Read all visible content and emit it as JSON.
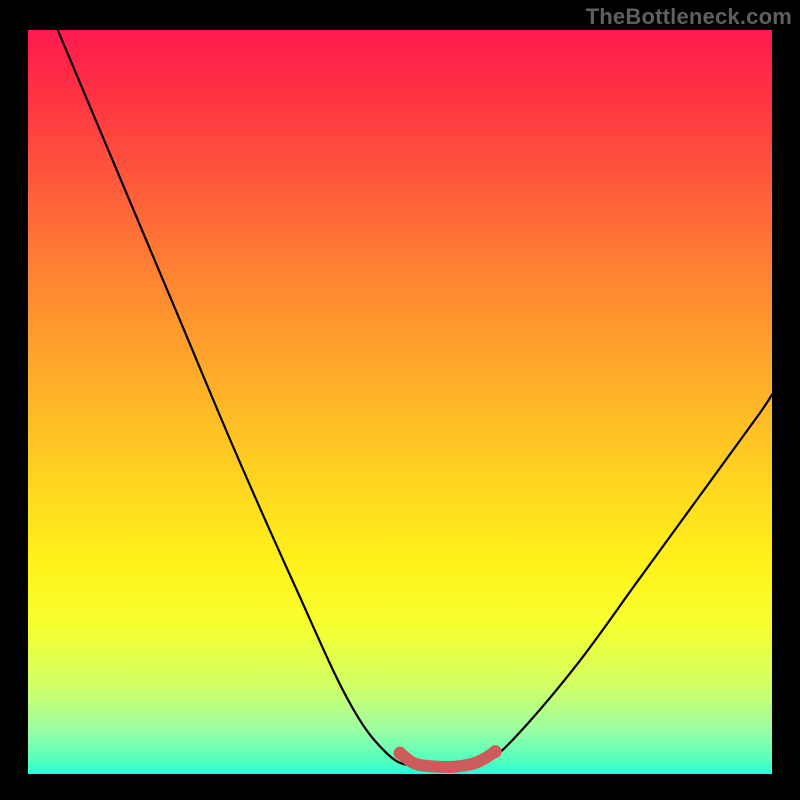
{
  "watermark": {
    "text": "TheBottleneck.com"
  },
  "chart_data": {
    "type": "line",
    "title": "",
    "xlabel": "",
    "ylabel": "",
    "xlim": [
      0,
      1
    ],
    "ylim": [
      0,
      1
    ],
    "series": [
      {
        "name": "bottleneck-curve",
        "points": [
          {
            "x": 0.04,
            "y": 1.0
          },
          {
            "x": 0.12,
            "y": 0.81
          },
          {
            "x": 0.2,
            "y": 0.62
          },
          {
            "x": 0.28,
            "y": 0.43
          },
          {
            "x": 0.36,
            "y": 0.25
          },
          {
            "x": 0.43,
            "y": 0.1
          },
          {
            "x": 0.48,
            "y": 0.03
          },
          {
            "x": 0.52,
            "y": 0.01
          },
          {
            "x": 0.58,
            "y": 0.01
          },
          {
            "x": 0.62,
            "y": 0.02
          },
          {
            "x": 0.66,
            "y": 0.055
          },
          {
            "x": 0.74,
            "y": 0.15
          },
          {
            "x": 0.82,
            "y": 0.26
          },
          {
            "x": 0.9,
            "y": 0.37
          },
          {
            "x": 0.98,
            "y": 0.48
          },
          {
            "x": 1.0,
            "y": 0.51
          }
        ]
      },
      {
        "name": "optimal-zone-highlight",
        "points": [
          {
            "x": 0.5,
            "y": 0.028
          },
          {
            "x": 0.52,
            "y": 0.014
          },
          {
            "x": 0.548,
            "y": 0.01
          },
          {
            "x": 0.576,
            "y": 0.01
          },
          {
            "x": 0.604,
            "y": 0.016
          },
          {
            "x": 0.628,
            "y": 0.03
          }
        ]
      }
    ],
    "colors": {
      "curve": "#000000",
      "highlight": "#ce5b5b",
      "gradient_top": "#ff1a4f",
      "gradient_bottom": "#1effe0"
    }
  }
}
